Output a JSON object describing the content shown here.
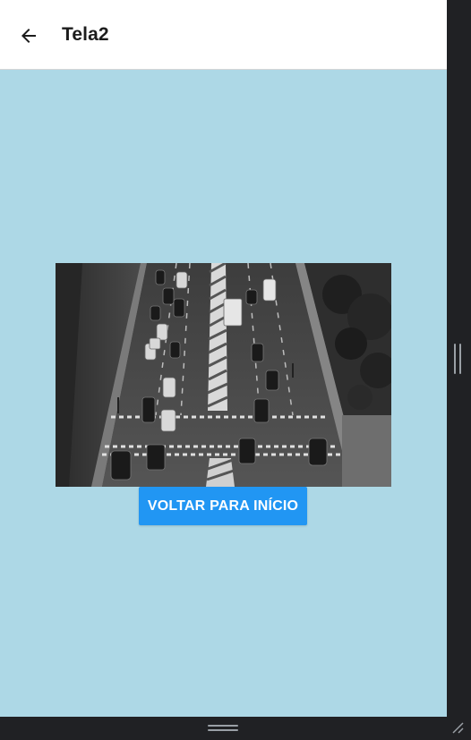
{
  "header": {
    "title": "Tela2",
    "back_icon": "arrow-left-icon"
  },
  "main": {
    "image_alt": "",
    "button_label": "VOLTAR PARA INÍCIO"
  },
  "colors": {
    "background": "#add8e6",
    "header_background": "#ffffff",
    "button": "#2196f3",
    "frame": "#202124"
  },
  "frame": {
    "right_handle_icon": "vertical-resize-handle-icon",
    "bottom_handle_icon": "horizontal-resize-handle-icon",
    "corner_icon": "resize-corner-icon"
  }
}
